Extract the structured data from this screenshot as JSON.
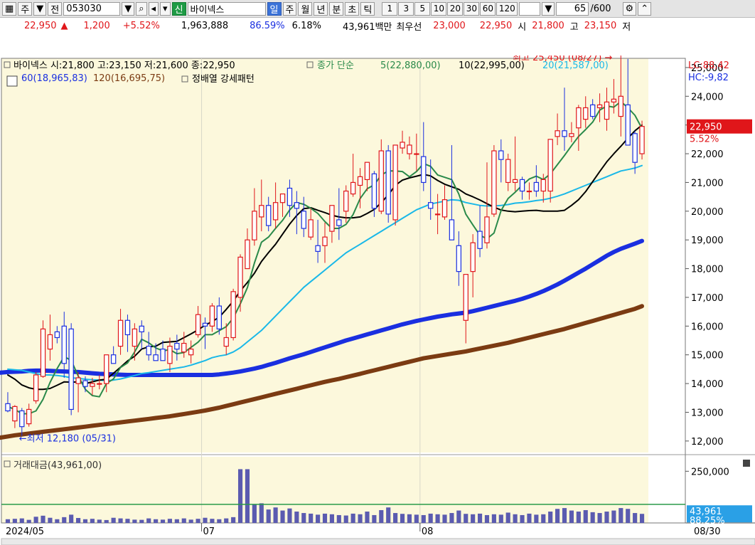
{
  "toolbar": {
    "market_btn": "주",
    "all_btn": "전",
    "code": "053030",
    "sin_badge": "신",
    "stock_name": "바이넥스",
    "periods": [
      "일",
      "주",
      "월",
      "년",
      "분",
      "초",
      "틱"
    ],
    "period_selected": "일",
    "intervals": [
      "1",
      "3",
      "5",
      "10",
      "20",
      "30",
      "60",
      "120"
    ],
    "count_value": "65",
    "count_total": "/600"
  },
  "quote": {
    "price": "22,950",
    "change": "1,200",
    "change_pct": "+5.52%",
    "volume": "1,963,888",
    "vol_ratio": "86.59%",
    "turnover": "6.18%",
    "amount": "43,961백만",
    "best_label": "최우선",
    "best_ask": "23,000",
    "best_bid": "22,950",
    "open_label": "시",
    "open": "21,800",
    "high_label": "고",
    "high": "23,150",
    "low_label": "저"
  },
  "colors": {
    "bg": "#fcf8dc",
    "up": "#e0161a",
    "down": "#1a2fe0",
    "ma5": "#2a8a4a",
    "ma10": "#000000",
    "ma20": "#19b8e8",
    "ma60": "#1a2fe0",
    "ma120": "#7b3b12",
    "vol": "#5b5bb0"
  },
  "chart_data": {
    "type": "candlestick",
    "price_panel": {
      "legend_line1": "바이넥스 시:21,800 고:23,150 저:21,600 종:22,950",
      "ma_title": "종가 단순",
      "ma_labels": [
        "5(22,880,00)",
        "10(22,995,00)",
        "20(21,587,00)",
        "60(18,965,83)",
        "120(16,695,75)"
      ],
      "pattern": "정배열 강세패턴",
      "y_ticks": [
        "25,000",
        "24,000",
        "23,000",
        "22,000",
        "21,000",
        "20,000",
        "19,000",
        "18,000",
        "17,000",
        "16,000",
        "15,000",
        "14,000",
        "13,000",
        "12,000"
      ],
      "y_tick_values": [
        25000,
        24000,
        23000,
        22000,
        21000,
        20000,
        19000,
        18000,
        17000,
        16000,
        15000,
        14000,
        13000,
        12000
      ],
      "ylim": [
        11600,
        25320
      ],
      "lc": "LC:88,42",
      "hc": "HC:-9,82",
      "last_price": "22,950",
      "last_pct": "5.52%",
      "high_note": "최고 25,450 (08/27) →",
      "low_note": "←최저 12,180 (05/31)",
      "candles": [
        [
          13300,
          13700,
          13000,
          13050
        ],
        [
          12700,
          13250,
          12450,
          13200
        ],
        [
          13050,
          13150,
          12180,
          12500
        ],
        [
          12600,
          13300,
          12500,
          13100
        ],
        [
          13400,
          14400,
          13300,
          14300
        ],
        [
          14250,
          16200,
          14200,
          15900
        ],
        [
          15200,
          16400,
          14800,
          15700
        ],
        [
          15800,
          16000,
          15400,
          15600
        ],
        [
          16000,
          16500,
          14200,
          14700
        ],
        [
          15900,
          16100,
          12900,
          13100
        ],
        [
          14000,
          14400,
          13000,
          14200
        ],
        [
          14100,
          14250,
          13700,
          13900
        ],
        [
          13900,
          14200,
          13600,
          14000
        ],
        [
          14000,
          14300,
          13800,
          14000
        ],
        [
          14000,
          15000,
          13700,
          15000
        ],
        [
          15000,
          15300,
          14800,
          14700
        ],
        [
          15300,
          16600,
          15000,
          16200
        ],
        [
          16200,
          16400,
          15100,
          15700
        ],
        [
          15300,
          16100,
          14800,
          15900
        ],
        [
          16000,
          16200,
          15200,
          15800
        ],
        [
          15300,
          15800,
          14800,
          15000
        ],
        [
          15000,
          15400,
          14900,
          14800
        ],
        [
          15200,
          15500,
          14900,
          14800
        ],
        [
          14700,
          15600,
          14400,
          15300
        ],
        [
          15400,
          15700,
          14800,
          15200
        ],
        [
          15100,
          15800,
          14900,
          15400
        ],
        [
          15000,
          15500,
          14700,
          15200
        ],
        [
          15700,
          16700,
          15600,
          16400
        ],
        [
          16100,
          16300,
          15200,
          16000
        ],
        [
          16000,
          16800,
          15800,
          16700
        ],
        [
          16700,
          17000,
          15700,
          15900
        ],
        [
          15300,
          16100,
          15000,
          15600
        ],
        [
          15600,
          17300,
          15500,
          17200
        ],
        [
          17000,
          18500,
          16500,
          18400
        ],
        [
          18000,
          19400,
          18000,
          19000
        ],
        [
          19000,
          20800,
          18800,
          20000
        ],
        [
          19800,
          21100,
          19300,
          20200
        ],
        [
          20200,
          20500,
          19300,
          19500
        ],
        [
          19700,
          21000,
          19400,
          20300
        ],
        [
          20300,
          20600,
          19800,
          20600
        ],
        [
          20800,
          21100,
          19800,
          20200
        ],
        [
          20300,
          20700,
          19200,
          20100
        ],
        [
          20000,
          20500,
          19100,
          19400
        ],
        [
          19100,
          20100,
          19000,
          19700
        ],
        [
          18800,
          19700,
          18200,
          18600
        ],
        [
          18800,
          19600,
          18200,
          19100
        ],
        [
          19300,
          20200,
          18900,
          20200
        ],
        [
          19700,
          20800,
          19000,
          19500
        ],
        [
          20000,
          20900,
          19600,
          20700
        ],
        [
          20600,
          22000,
          20500,
          21000
        ],
        [
          20900,
          21500,
          20100,
          21200
        ],
        [
          21100,
          21700,
          20700,
          21700
        ],
        [
          21300,
          21400,
          19800,
          20100
        ],
        [
          20000,
          22500,
          19900,
          22100
        ],
        [
          22100,
          22300,
          19600,
          19900
        ],
        [
          19700,
          22200,
          19500,
          22300
        ],
        [
          22200,
          22800,
          22000,
          22400
        ],
        [
          22000,
          22600,
          21800,
          22300
        ],
        [
          22000,
          22700,
          21400,
          22000
        ],
        [
          21900,
          23100,
          20700,
          21000
        ],
        [
          20300,
          21800,
          19700,
          20100
        ],
        [
          19900,
          20600,
          19200,
          19900
        ],
        [
          19800,
          20900,
          19700,
          20400
        ],
        [
          19700,
          22300,
          19200,
          19000
        ],
        [
          18800,
          19300,
          17400,
          17900
        ],
        [
          16200,
          17700,
          15400,
          17800
        ],
        [
          17900,
          19200,
          17000,
          18900
        ],
        [
          19300,
          20200,
          18400,
          18700
        ],
        [
          18900,
          21700,
          18700,
          19800
        ],
        [
          19900,
          22300,
          19800,
          22100
        ],
        [
          22100,
          22500,
          21000,
          21800
        ],
        [
          21000,
          22000,
          20700,
          21800
        ],
        [
          21000,
          22600,
          20700,
          21100
        ],
        [
          21100,
          21200,
          20400,
          20700
        ],
        [
          20700,
          21000,
          20400,
          20700
        ],
        [
          21000,
          21600,
          20500,
          20700
        ],
        [
          20700,
          21300,
          20300,
          21100
        ],
        [
          20700,
          22500,
          20300,
          22500
        ],
        [
          22600,
          23400,
          22300,
          22800
        ],
        [
          22800,
          24300,
          22100,
          22600
        ],
        [
          22600,
          23100,
          22400,
          22700
        ],
        [
          22900,
          23700,
          22100,
          23600
        ],
        [
          23200,
          24000,
          22900,
          23600
        ],
        [
          23700,
          23900,
          23200,
          23300
        ],
        [
          23600,
          24100,
          23100,
          23700
        ],
        [
          23200,
          24300,
          22800,
          23800
        ],
        [
          23800,
          24600,
          23400,
          23900
        ],
        [
          23300,
          25450,
          22600,
          24000
        ],
        [
          23700,
          25300,
          22500,
          22300
        ],
        [
          22700,
          22800,
          21300,
          21700
        ],
        [
          22000,
          23150,
          21800,
          22950
        ]
      ],
      "ma5": [
        13200,
        13100,
        12950,
        12950,
        13050,
        13450,
        14040,
        14520,
        14940,
        14800,
        14260,
        13800,
        13580,
        13540,
        14000,
        14160,
        14560,
        14720,
        15100,
        15540,
        15420,
        15240,
        15140,
        15180,
        15040,
        15080,
        15260,
        15440,
        15700,
        15700,
        15840,
        15980,
        16280,
        16780,
        17340,
        18200,
        18920,
        19100,
        19400,
        19680,
        20040,
        20300,
        20240,
        20100,
        19920,
        19640,
        19400,
        19400,
        19540,
        19880,
        20440,
        20780,
        20920,
        21260,
        21400,
        21400,
        21380,
        21200,
        21380,
        21660,
        21560,
        21260,
        21180,
        21100,
        20600,
        19900,
        19520,
        19160,
        19040,
        19240,
        20020,
        20440,
        20660,
        20900,
        21120,
        21220,
        21100,
        21300,
        21620,
        21940,
        22280,
        22600,
        22840,
        23100,
        23520,
        23660,
        23620,
        23820,
        23600,
        23340,
        22880
      ],
      "ma10": [
        14300,
        14150,
        13950,
        13850,
        13800,
        13800,
        13830,
        13940,
        14060,
        14050,
        14060,
        14000,
        14060,
        14120,
        14150,
        14360,
        14570,
        14790,
        14950,
        15200,
        15280,
        15300,
        15430,
        15450,
        15470,
        15600,
        15730,
        15870,
        16030,
        16160,
        16310,
        16580,
        16870,
        17230,
        17520,
        17840,
        18250,
        18560,
        18850,
        19200,
        19550,
        19850,
        20090,
        20120,
        20030,
        19950,
        19860,
        19800,
        19770,
        19770,
        19800,
        19920,
        20060,
        20300,
        20570,
        20900,
        21080,
        21160,
        21220,
        21280,
        21230,
        21070,
        20940,
        20850,
        20760,
        20600,
        20500,
        20390,
        20260,
        20140,
        20040,
        20000,
        19980,
        20000,
        20020,
        20030,
        20000,
        20000,
        20000,
        20030,
        20200,
        20400,
        20680,
        21030,
        21380,
        21720,
        22000,
        22260,
        22540,
        22800,
        22995
      ],
      "ma20": [
        14500,
        14480,
        14460,
        14400,
        14350,
        14300,
        14300,
        14280,
        14250,
        14200,
        14180,
        14150,
        14130,
        14120,
        14100,
        14120,
        14160,
        14220,
        14280,
        14350,
        14380,
        14420,
        14460,
        14500,
        14540,
        14580,
        14640,
        14720,
        14800,
        14900,
        14960,
        15000,
        15100,
        15250,
        15450,
        15650,
        15850,
        16100,
        16350,
        16600,
        16850,
        17100,
        17350,
        17550,
        17750,
        17950,
        18150,
        18350,
        18550,
        18700,
        18850,
        19000,
        19150,
        19300,
        19450,
        19600,
        19750,
        19900,
        20050,
        20150,
        20250,
        20300,
        20350,
        20400,
        20380,
        20300,
        20250,
        20200,
        20180,
        20180,
        20200,
        20230,
        20280,
        20300,
        20330,
        20370,
        20400,
        20450,
        20520,
        20600,
        20700,
        20800,
        20900,
        21000,
        21100,
        21200,
        21300,
        21400,
        21450,
        21500,
        21587
      ],
      "ma60": [
        14300,
        14300,
        14320,
        14350,
        14380,
        14400,
        14410,
        14420,
        14440,
        14450,
        14450,
        14440,
        14430,
        14420,
        14410,
        14400,
        14380,
        14360,
        14340,
        14330,
        14320,
        14310,
        14300,
        14300,
        14300,
        14300,
        14300,
        14300,
        14300,
        14300,
        14300,
        14300,
        14300,
        14300,
        14300,
        14320,
        14350,
        14380,
        14420,
        14470,
        14520,
        14580,
        14650,
        14720,
        14800,
        14880,
        14950,
        15020,
        15100,
        15180,
        15260,
        15340,
        15420,
        15500,
        15570,
        15640,
        15710,
        15780,
        15850,
        15920,
        15990,
        16060,
        16120,
        16180,
        16230,
        16280,
        16330,
        16370,
        16410,
        16440,
        16470,
        16520,
        16580,
        16640,
        16700,
        16760,
        16820,
        16880,
        16950,
        17030,
        17120,
        17220,
        17330,
        17450,
        17580,
        17720,
        17860,
        18000,
        18150,
        18300,
        18450,
        18580,
        18690,
        18780,
        18870,
        18965
      ],
      "ma120": [
        11900,
        11950,
        12000,
        12040,
        12080,
        12120,
        12160,
        12200,
        12230,
        12260,
        12290,
        12320,
        12350,
        12380,
        12410,
        12440,
        12470,
        12500,
        12530,
        12560,
        12590,
        12620,
        12650,
        12680,
        12710,
        12740,
        12770,
        12800,
        12830,
        12860,
        12900,
        12940,
        12980,
        13020,
        13060,
        13110,
        13160,
        13220,
        13280,
        13340,
        13400,
        13460,
        13520,
        13580,
        13640,
        13700,
        13760,
        13820,
        13880,
        13940,
        14000,
        14060,
        14110,
        14160,
        14220,
        14280,
        14340,
        14400,
        14460,
        14520,
        14580,
        14640,
        14700,
        14760,
        14820,
        14880,
        14920,
        14960,
        15000,
        15040,
        15080,
        15120,
        15170,
        15220,
        15270,
        15320,
        15370,
        15420,
        15480,
        15540,
        15600,
        15660,
        15720,
        15780,
        15840,
        15900,
        15970,
        16040,
        16110,
        16180,
        16250,
        16320,
        16390,
        16460,
        16530,
        16600,
        16695
      ]
    },
    "volume_panel": {
      "legend": "거래대금(43,961,00)",
      "y_ticks": [
        "250,000"
      ],
      "y_tick_values": [
        250000
      ],
      "ylim": [
        0,
        320000
      ],
      "ref_line": 90000,
      "last_value": "43,961",
      "last_pct": "88.25%",
      "values": [
        18000,
        20000,
        22000,
        15000,
        30000,
        35000,
        25000,
        18000,
        28000,
        40000,
        24000,
        18000,
        20000,
        16000,
        14000,
        25000,
        22000,
        20000,
        16000,
        15000,
        22000,
        18000,
        16000,
        20000,
        18000,
        22000,
        16000,
        20000,
        25000,
        20000,
        18000,
        22000,
        28000,
        260000,
        260000,
        90000,
        95000,
        65000,
        75000,
        60000,
        70000,
        55000,
        48000,
        45000,
        40000,
        45000,
        42000,
        38000,
        36000,
        45000,
        42000,
        55000,
        38000,
        62000,
        75000,
        48000,
        44000,
        42000,
        40000,
        38000,
        45000,
        42000,
        40000,
        48000,
        60000,
        44000,
        42000,
        45000,
        38000,
        42000,
        40000,
        50000,
        42000,
        38000,
        45000,
        40000,
        42000,
        55000,
        68000,
        72000,
        60000,
        55000,
        62000,
        52000,
        48000,
        55000,
        60000,
        72000,
        68000,
        48000,
        43961
      ]
    },
    "x_labels": [
      {
        "label": "2024/05",
        "index": 0
      },
      {
        "label": "07",
        "index": 28
      },
      {
        "label": "08",
        "index": 59
      },
      {
        "label": "08/30",
        "index": 90
      }
    ]
  }
}
